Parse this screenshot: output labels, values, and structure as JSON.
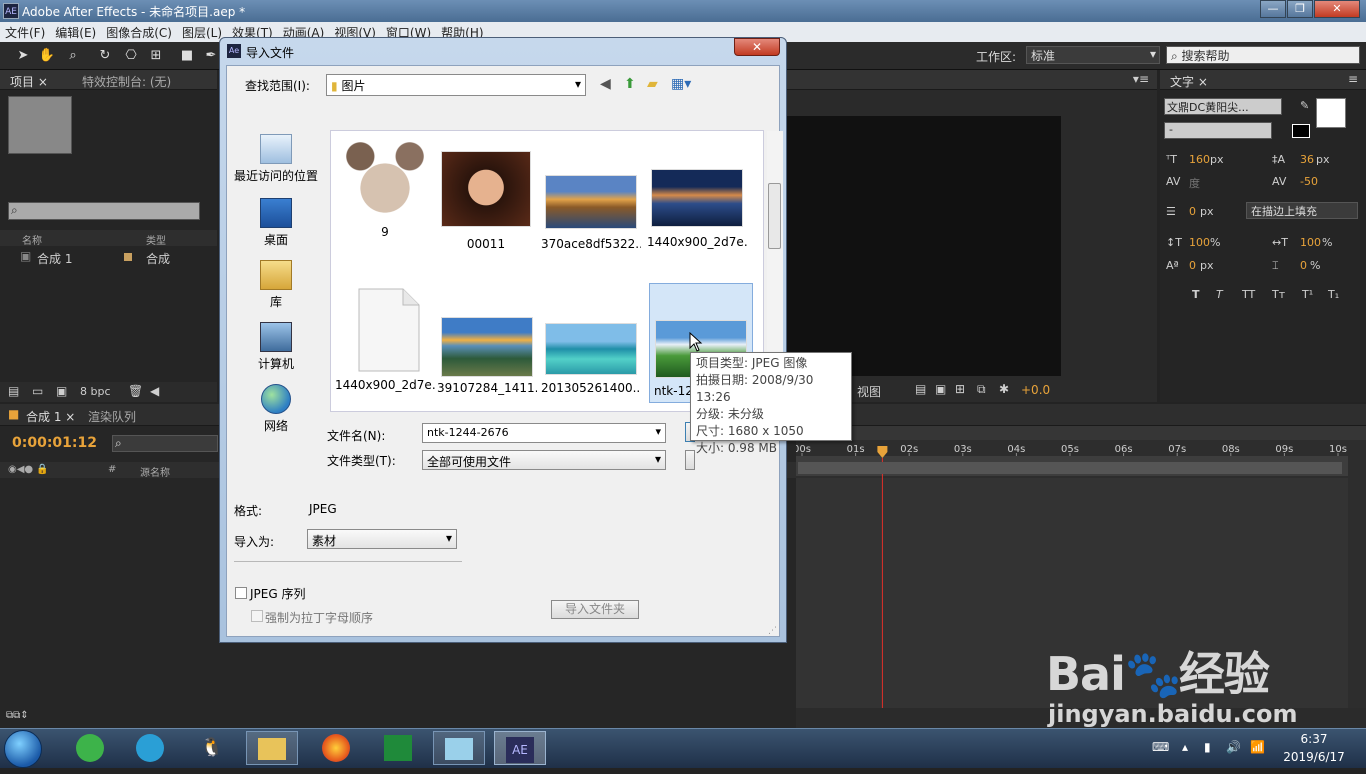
{
  "window": {
    "title": "Adobe After Effects - 未命名项目.aep *",
    "app_badge": "AE",
    "min": "—",
    "max": "❐",
    "close": "✕"
  },
  "menu": [
    "文件(F)",
    "编辑(E)",
    "图像合成(C)",
    "图层(L)",
    "效果(T)",
    "动画(A)",
    "视图(V)",
    "窗口(W)",
    "帮助(H)"
  ],
  "toolbar": {
    "workspace_label": "工作区:",
    "workspace_value": "标准",
    "search_help": "搜索帮助"
  },
  "project_panel": {
    "tabs": [
      "项目 ×",
      "特效控制台: (无)"
    ],
    "columns": [
      "名称",
      "类型"
    ],
    "items": [
      {
        "name": "合成 1",
        "type": "合成"
      }
    ],
    "bpc": "8 bpc"
  },
  "text_panel": {
    "tab": "文字 ×",
    "font": "文鼎DC黄阳尖...",
    "style": "-",
    "size": "160",
    "size_unit": "px",
    "leading": "36",
    "leading_unit": "px",
    "kerning": "度",
    "tracking": "-50",
    "stroke": "0",
    "stroke_unit": "px",
    "stroke_mode": "在描边上填充",
    "vscale": "100",
    "vscale_unit": "%",
    "hscale": "100",
    "hscale_unit": "%",
    "baseline": "0",
    "baseline_unit": "px",
    "tsume": "0",
    "tsume_unit": "%",
    "styles": [
      "T",
      "T",
      "TT",
      "Tт",
      "T¹",
      "T₁"
    ]
  },
  "viewer": {
    "view_label": "视图",
    "exposure": "+0.0"
  },
  "timeline": {
    "tabs": [
      "合成 1 ×",
      "渲染队列"
    ],
    "timecode": "0:00:01:12",
    "columns": [
      "#",
      "源名称"
    ],
    "ticks": [
      "00s",
      "01s",
      "02s",
      "03s",
      "04s",
      "05s",
      "06s",
      "07s",
      "08s",
      "09s",
      "10s"
    ],
    "playhead_seconds": 1.5
  },
  "dialog": {
    "title": "导入文件",
    "close": "✕",
    "lookin_label": "查找范围(I):",
    "lookin_value": "图片",
    "sidebar": [
      "最近访问的位置",
      "桌面",
      "库",
      "计算机",
      "网络"
    ],
    "files": [
      "9",
      "00011",
      "370ace8df5322...",
      "1440x900_2d7e...",
      "1440x900_2d7e...",
      "39107284_1411...",
      "201305261400...",
      "ntk-12"
    ],
    "filename_label": "文件名(N):",
    "filename_value": "ntk-1244-2676",
    "filetype_label": "文件类型(T):",
    "filetype_value": "全部可使用文件",
    "format_label": "格式:",
    "format_value": "JPEG",
    "import_as_label": "导入为:",
    "import_as_value": "素材",
    "sequence_label": "JPEG 序列",
    "alpha_label": "强制为拉丁字母顺序",
    "import_folder": "导入文件夹"
  },
  "tooltip": {
    "lines": [
      "项目类型: JPEG 图像",
      "拍摄日期: 2008/9/30 13:26",
      "分级: 未分级",
      "尺寸: 1680 x 1050",
      "大小: 0.98 MB"
    ]
  },
  "watermark": {
    "brand": "Bai",
    "brand2": "经验",
    "url": "jingyan.baidu.com"
  },
  "taskbar": {
    "time": "6:37",
    "date": "2019/6/17",
    "ae": "AE"
  }
}
